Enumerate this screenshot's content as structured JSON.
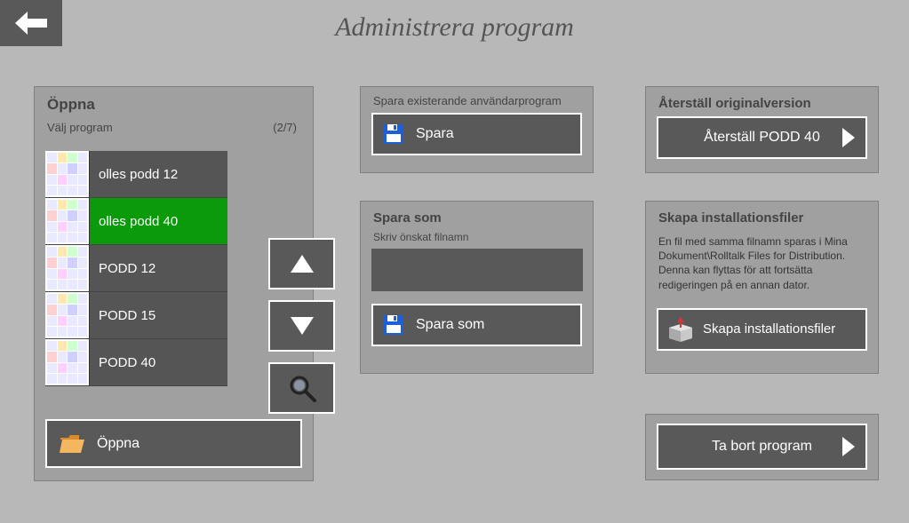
{
  "title": "Administrera program",
  "open": {
    "title": "Öppna",
    "list_label": "Välj program",
    "pager": "(2/7)",
    "items": [
      {
        "label": "olles podd 12",
        "selected": false
      },
      {
        "label": "olles podd 40",
        "selected": true
      },
      {
        "label": "PODD 12",
        "selected": false
      },
      {
        "label": "PODD 15",
        "selected": false
      },
      {
        "label": "PODD 40",
        "selected": false
      }
    ],
    "open_btn": "Öppna"
  },
  "save": {
    "title": "Spara existerande användarprogram",
    "btn": "Spara"
  },
  "save_as": {
    "title": "Spara som",
    "subtitle": "Skriv önskat filnamn",
    "value": "",
    "btn": "Spara som"
  },
  "restore": {
    "title": "Återställ originalversion",
    "btn": "Återställ PODD 40"
  },
  "install": {
    "title": "Skapa installationsfiler",
    "desc": "En fil med samma filnamn sparas i Mina Dokument\\Rolltalk Files for Distribution. Denna kan flyttas för att fortsätta redigeringen på en annan dator.",
    "btn": "Skapa installationsfiler"
  },
  "delete": {
    "btn": "Ta bort program"
  }
}
